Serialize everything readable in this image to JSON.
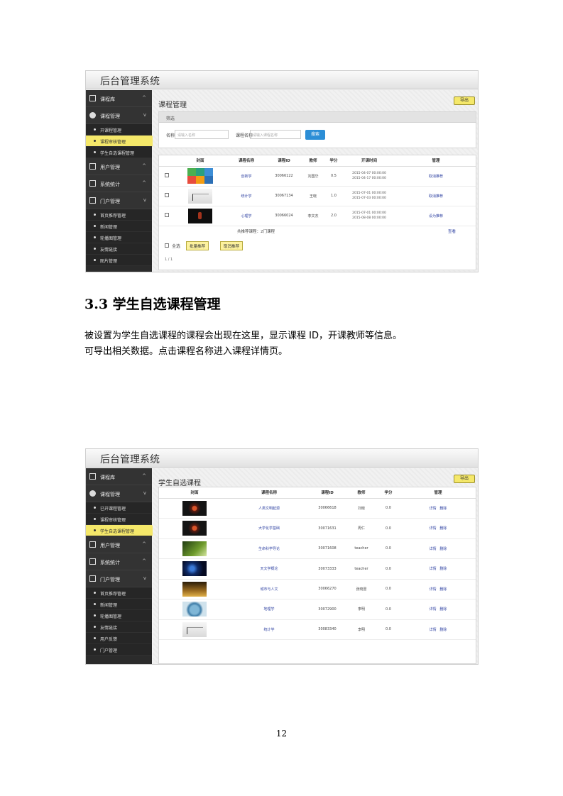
{
  "screenshot1": {
    "brand": "后台管理系统",
    "sidebar": {
      "groups": [
        {
          "label": "课程库",
          "chevron": "^"
        },
        {
          "label": "课程管理",
          "chevron": "v"
        },
        {
          "label": "用户管理",
          "chevron": "^"
        },
        {
          "label": "系统统计",
          "chevron": "^"
        },
        {
          "label": "门户管理",
          "chevron": "v"
        }
      ],
      "course_subs": [
        "开课程管理",
        "课程审核管理",
        "学生自选课程管理"
      ],
      "portal_subs": [
        "首页推荐管理",
        "新闻管理",
        "轮播图管理",
        "友情链接",
        "图片管理"
      ]
    },
    "page_title": "课程管理",
    "export_label": "导出",
    "filter": {
      "head": "筛选",
      "label1": "名称",
      "placeholder1": "请输入名称",
      "label2": "课程名称",
      "placeholder2": "请输入课程名称",
      "search": "搜索"
    },
    "table": {
      "headers": [
        "",
        "封面",
        "课程名称",
        "课程ID",
        "教师",
        "学分",
        "开课时间",
        "管理"
      ],
      "rows": [
        {
          "name": "创新学",
          "id": "30066122",
          "teacher": "刘国华",
          "credit": "0.5",
          "start": "2015-04-07 00:00:00",
          "end": "2015-04-17 00:00:00",
          "op": "取消推荐"
        },
        {
          "name": "统计学",
          "id": "30067134",
          "teacher": "王晓",
          "credit": "1.0",
          "start": "2015-07-01 00:00:00",
          "end": "2015-07-03 00:00:00",
          "op": "取消推荐"
        },
        {
          "name": "心理学",
          "id": "30066024",
          "teacher": "李文杰",
          "credit": "2.0",
          "start": "2015-07-01 00:00:00",
          "end": "2015-08-08 00:00:00",
          "op": "设为推荐"
        }
      ],
      "summary": "共推荐课程：2门课程",
      "summary_link": "查看",
      "select_all": "全选",
      "action1": "批量推荐",
      "action2": "取消推荐",
      "pager": "1 / 1"
    }
  },
  "heading": "3.3 学生自选课程管理",
  "para1": "被设置为学生自选课程的课程会出现在这里，显示课程 ID，开课教师等信息。",
  "para2": "可导出相关数据。点击课程名称进入课程详情页。",
  "screenshot2": {
    "brand": "后台管理系统",
    "sidebar": {
      "groups": [
        {
          "label": "课程库",
          "chevron": "^"
        },
        {
          "label": "课程管理",
          "chevron": "v"
        },
        {
          "label": "用户管理",
          "chevron": "^"
        },
        {
          "label": "系统统计",
          "chevron": "^"
        },
        {
          "label": "门户管理",
          "chevron": "v"
        }
      ],
      "course_subs": [
        "已开课程管理",
        "课程审核管理",
        "学生自选课程管理"
      ],
      "portal_subs": [
        "首页推荐管理",
        "新闻管理",
        "轮播图管理",
        "友情链接",
        "用户反馈",
        "门户管理"
      ]
    },
    "page_title": "学生自选课程",
    "export_label": "导出",
    "table": {
      "headers": [
        "封面",
        "课程名称",
        "课程ID",
        "教师",
        "学分",
        "管理"
      ],
      "rows": [
        {
          "thumb": "swirl",
          "name": "人类文明起源",
          "id": "30066618",
          "teacher": "刘晓",
          "credit": "0.0",
          "op1": "详情",
          "op2": "删除"
        },
        {
          "thumb": "swirl",
          "name": "大学化学基础",
          "id": "30071631",
          "teacher": "周仁",
          "credit": "0.0",
          "op1": "详情",
          "op2": "删除"
        },
        {
          "thumb": "leaf",
          "name": "生命科学导论",
          "id": "30071608",
          "teacher": "teacher",
          "credit": "0.0",
          "op1": "详情",
          "op2": "删除"
        },
        {
          "thumb": "space",
          "name": "天文学概论",
          "id": "30073333",
          "teacher": "teacher",
          "credit": "0.0",
          "op1": "详情",
          "op2": "删除"
        },
        {
          "thumb": "city",
          "name": "城市与人文",
          "id": "30066270",
          "teacher": "张晓雷",
          "credit": "0.0",
          "op1": "详情",
          "op2": "删除"
        },
        {
          "thumb": "globe",
          "name": "地理学",
          "id": "30072900",
          "teacher": "李明",
          "credit": "0.0",
          "op1": "详情",
          "op2": "删除"
        },
        {
          "thumb": "chart",
          "name": "统计学",
          "id": "30083340",
          "teacher": "李明",
          "credit": "0.0",
          "op1": "详情",
          "op2": "删除"
        }
      ]
    }
  },
  "page_number": "12",
  "colors": {
    "accent_yellow": "#f5e86a",
    "sidebar_bg": "#2b2b2b",
    "link_blue": "#3144a3",
    "search_blue": "#2c8ed6"
  }
}
